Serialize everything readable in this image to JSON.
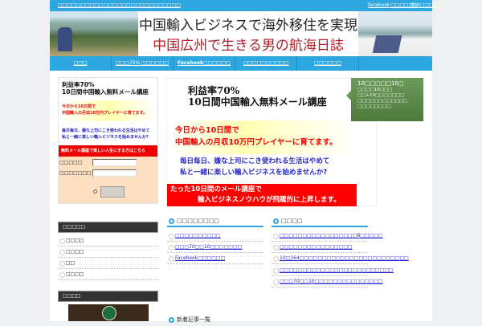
{
  "topbar": {
    "site_link": "□□□□□□□□□□□□□□□□□□□□□□□□□□□",
    "links": [
      "facebook",
      "□□□□□□",
      "RSS□□□□"
    ]
  },
  "header": {
    "title": "中国輸入ビジネスで海外移住を実現",
    "subtitle": "中国広州で生きる男の航海日誌"
  },
  "nav": [
    "□□□",
    "□□□70% □□□□□□",
    "Facebook□□□□□□",
    "□□□□□□□□□□",
    "□□□□□□",
    ""
  ],
  "form": {
    "title1": "利益率70%",
    "title2": "10日間中国輸入無料メール講座",
    "yellow1": "今日から10日間で",
    "yellow2": "中国輸入の月収10万円プレイヤーに育てます。",
    "blue1": "毎日毎日、嫌な上司にこき使われる生活はやめて",
    "blue2": "私と一緒に楽しい輸入ビジネスを始めませんか?",
    "cta": "無料メール講座で楽しい人生にする方はこちら",
    "label_name": "□□□□□",
    "label_email": "□□□□□□□"
  },
  "banner": {
    "title1": "利益率70%",
    "title2": "10日間中国輸入無料メール講座",
    "yellow1": "今日から10日間で",
    "yellow2": "中国輸入の月収10万円プレイヤーに育てます。",
    "blue1": "毎日毎日、嫌な上司にこき使われる生活はやめて",
    "blue2": "私と一緒に楽しい輸入ビジネスを始めませんか?",
    "red1": "たった10日間のメール講座で",
    "red2": "輸入ビジネスノウハウが飛躍的に上昇します。"
  },
  "callout": {
    "title": "10□□□□□10□",
    "lines": [
      "□□□□10□□□",
      "□□+10□□□□□□□",
      "□□□□□□□□□□□□",
      "□□□□□□□□"
    ]
  },
  "section_left": {
    "title": "□□□□□□□□",
    "items": [
      "□□□□□□□□□□",
      "□□□70□□10□□□□□□□",
      "Facebook□□□□□□"
    ]
  },
  "section_right": {
    "title": "□□□□",
    "items": [
      "□□□□□□□□□□□□□□□□□8□□□□□",
      "□□□□□□□□□□□□□□□□",
      "10□164□□□□□□□□□□□□□□□□□□□□□□□□",
      "□□□□□□□□□□□□□□□□□□□□□□□□□",
      "□□□70□□10□□□□□□□□□□□□□□□"
    ]
  },
  "section_new": {
    "title": "新着記事一覧"
  },
  "sidebar": {
    "cat_title": "□□□□□",
    "cats": [
      "□□□□",
      "□□□□",
      "□□",
      "□□□□"
    ],
    "profile_title": "□□□□"
  }
}
